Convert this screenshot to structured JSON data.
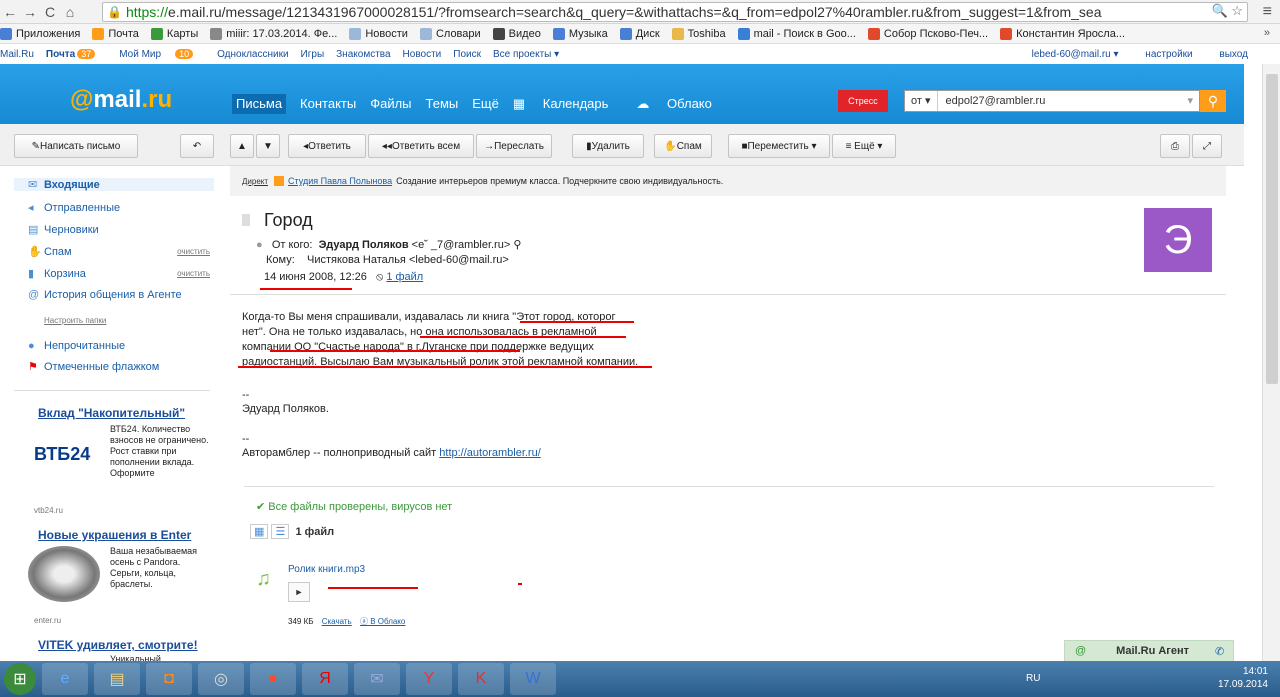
{
  "browser": {
    "url_https": "https://",
    "url_rest": "e.mail.ru/message/1213431967000028151/?fromsearch=search&q_query=&withattachs=&q_from=edpol27%40rambler.ru&from_suggest=1&from_sea"
  },
  "bookmarks": [
    "Приложения",
    "Почта",
    "Карты",
    "miiir: 17.03.2014. Фе...",
    "Новости",
    "Словари",
    "Видео",
    "Музыка",
    "Диск",
    "Toshiba",
    "mail - Поиск в Goo...",
    "Собор Псково-Печ...",
    "Константин Яросла..."
  ],
  "portal": {
    "mailru": "Mail.Ru",
    "pochta": "Почта",
    "pochta_count": "37",
    "moi_mir": "Мой Мир",
    "moi_mir_count": "10",
    "odnoklassniki": "Одноклассники",
    "igry": "Игры",
    "znakomstva": "Знакомства",
    "novosti": "Новости",
    "poisk": "Поиск",
    "all": "Все проекты ▾",
    "user": "lebed-60@mail.ru ▾",
    "settings": "настройки",
    "logout": "выход"
  },
  "header": {
    "logo_at": "@",
    "logo_mail": "mail",
    "logo_ru": ".ru",
    "nav": [
      "Письма",
      "Контакты",
      "Файлы",
      "Темы",
      "Ещё"
    ],
    "calendar": "Календарь",
    "cloud": "Облако",
    "stress": "Стресс",
    "search_from": "от ▾",
    "search_value": "edpol27@rambler.ru"
  },
  "toolbar": {
    "compose": "Написать письмо",
    "reply": "Ответить",
    "reply_all": "Ответить всем",
    "forward": "Переслать",
    "delete": "Удалить",
    "spam": "Спам",
    "move": "Переместить ▾",
    "more": "≡ Ещё ▾"
  },
  "sidebar": {
    "inbox": "Входящие",
    "sent": "Отправленные",
    "drafts": "Черновики",
    "spam": "Спам",
    "trash": "Корзина",
    "clean": "очистить",
    "agent_history": "История общения в Агенте",
    "setup": "Настроить папки",
    "unread": "Непрочитанные",
    "flagged": "Отмеченные флажком"
  },
  "ads": [
    {
      "title": "Вклад \"Накопительный\"",
      "text": "ВТБ24. Количество взносов не ограничено. Рост ставки при пополнении вклада. Оформите",
      "host": "vtb24.ru",
      "logo": "ВТБ24"
    },
    {
      "title": "Новые украшения в Enter",
      "text": "Ваша незабываемая осень с Pandora. Серьги, кольца, браслеты.",
      "host": "enter.ru"
    },
    {
      "title": "VITEK удивляет, смотрите!",
      "text": "Уникальный"
    }
  ],
  "direct": {
    "label": "Директ",
    "link": "Студия Павла Полынова",
    "text": "Создание интерьеров премиум класса. Подчеркните свою индивидуальность."
  },
  "message": {
    "subject": "Город",
    "from_label": "От кого:",
    "from_name": "Эдуард Поляков",
    "from_email": "<e˘    _7@rambler.ru>",
    "to_label": "Кому:",
    "to_value": "Чистякова Наталья <lebed-60@mail.ru>",
    "date": "14 июня 2008, 12:26",
    "files_link": "1 файл",
    "avatar_letter": "Э",
    "body": [
      "Когда-то Вы меня спрашивали, издавалась ли книга \"Этот город, которог",
      "нет\". Она не только издавалась, но она использовалась в рекламной",
      "компании ОО \"Счастье народа\" в г.Луганске при поддержке ведущих",
      "радиостанций. Высылаю Вам музыкальный ролик этой рекламной компании."
    ],
    "sig_dash": "--",
    "signature": "Эдуард Поляков.",
    "footer_dash": "--",
    "footer_text": "Авторамблер -- полноприводный сайт ",
    "footer_link": "http://autorambler.ru/"
  },
  "attachments": {
    "ok": "Все файлы проверены, вирусов нет",
    "count": "1 файл",
    "file_name": "Ролик книги.mp3",
    "size": "349 КБ",
    "download": "Скачать",
    "cloud": "В Облако"
  },
  "agent": {
    "label": "Mail.Ru Агент"
  },
  "tray": {
    "lang": "RU",
    "time": "14:01",
    "date": "17.09.2014"
  }
}
